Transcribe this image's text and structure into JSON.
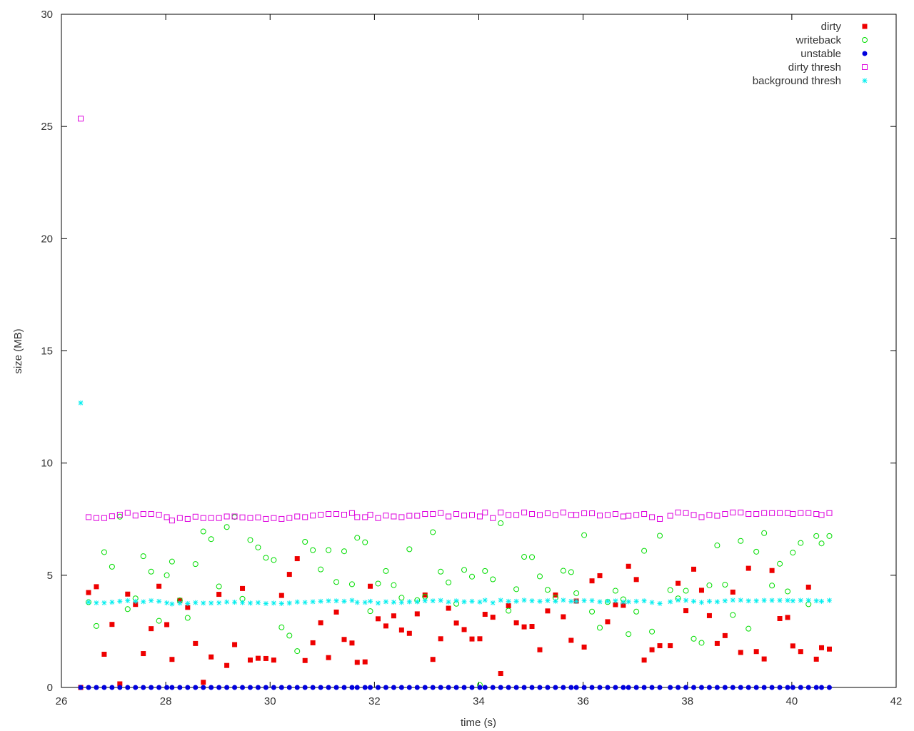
{
  "chart_data": {
    "type": "scatter",
    "title": "",
    "xlabel": "time (s)",
    "ylabel": "size (MB)",
    "xlim": [
      26,
      42
    ],
    "ylim": [
      0,
      30
    ],
    "xticks": [
      "26",
      "28",
      "30",
      "32",
      "34",
      "36",
      "38",
      "40",
      "42"
    ],
    "yticks": [
      "0",
      "5",
      "10",
      "15",
      "20",
      "25",
      "30"
    ],
    "grid": false,
    "legend_position": "top-right",
    "series": [
      {
        "name": "dirty",
        "color": "#ee0000",
        "marker": "filled-square",
        "x": [
          26.37,
          26.52,
          26.67,
          26.82,
          26.97,
          27.12,
          27.27,
          27.42,
          27.57,
          27.72,
          27.87,
          28.02,
          28.12,
          28.27,
          28.42,
          28.57,
          28.72,
          28.87,
          29.02,
          29.17,
          29.32,
          29.47,
          29.62,
          29.77,
          29.92,
          30.07,
          30.22,
          30.37,
          30.52,
          30.67,
          30.82,
          30.97,
          31.12,
          31.27,
          31.42,
          31.57,
          31.67,
          31.82,
          31.92,
          32.07,
          32.22,
          32.37,
          32.52,
          32.67,
          32.82,
          32.97,
          33.12,
          33.27,
          33.42,
          33.57,
          33.72,
          33.87,
          34.02,
          34.12,
          34.27,
          34.42,
          34.57,
          34.72,
          34.87,
          35.02,
          35.17,
          35.32,
          35.47,
          35.62,
          35.77,
          35.87,
          36.02,
          36.17,
          36.32,
          36.47,
          36.62,
          36.77,
          36.87,
          37.02,
          37.17,
          37.32,
          37.47,
          37.67,
          37.82,
          37.97,
          38.12,
          38.27,
          38.42,
          38.57,
          38.72,
          38.87,
          39.02,
          39.17,
          39.32,
          39.47,
          39.62,
          39.77,
          39.92,
          40.02,
          40.17,
          40.32,
          40.47,
          40.57,
          40.72
        ],
        "y": [
          0.0,
          4.23,
          4.49,
          1.48,
          2.81,
          0.16,
          4.16,
          3.7,
          1.51,
          2.62,
          4.51,
          2.8,
          1.25,
          3.88,
          3.57,
          1.96,
          0.23,
          1.36,
          4.15,
          0.98,
          1.91,
          4.41,
          1.22,
          1.3,
          1.29,
          1.22,
          4.1,
          5.04,
          5.74,
          1.2,
          1.99,
          2.88,
          1.33,
          3.36,
          2.14,
          1.98,
          1.12,
          1.14,
          4.51,
          3.06,
          2.74,
          3.19,
          2.56,
          2.41,
          3.28,
          4.12,
          1.25,
          2.17,
          3.53,
          2.87,
          2.58,
          2.16,
          2.17,
          3.26,
          3.13,
          0.62,
          3.64,
          2.88,
          2.7,
          2.72,
          1.68,
          3.41,
          4.12,
          3.15,
          2.1,
          3.85,
          1.8,
          4.75,
          4.98,
          2.93,
          3.69,
          3.66,
          5.4,
          4.81,
          1.22,
          1.68,
          1.86,
          1.86,
          4.64,
          3.42,
          5.27,
          4.33,
          3.2,
          1.96,
          2.31,
          4.25,
          1.56,
          5.31,
          1.6,
          1.27,
          5.21,
          3.07,
          3.12,
          1.85,
          1.6,
          4.47,
          1.26,
          1.77,
          1.71
        ]
      },
      {
        "name": "writeback",
        "color": "#00dd00",
        "marker": "open-circle",
        "x": [
          26.52,
          26.67,
          26.82,
          26.97,
          27.12,
          27.27,
          27.42,
          27.57,
          27.72,
          27.87,
          28.02,
          28.12,
          28.27,
          28.42,
          28.57,
          28.72,
          28.87,
          29.02,
          29.17,
          29.32,
          29.47,
          29.62,
          29.77,
          29.92,
          30.07,
          30.22,
          30.37,
          30.52,
          30.67,
          30.82,
          30.97,
          31.12,
          31.27,
          31.42,
          31.57,
          31.67,
          31.82,
          31.92,
          32.07,
          32.22,
          32.37,
          32.52,
          32.67,
          32.82,
          32.97,
          33.12,
          33.27,
          33.42,
          33.57,
          33.72,
          33.87,
          34.02,
          34.12,
          34.27,
          34.42,
          34.57,
          34.72,
          34.87,
          35.02,
          35.17,
          35.32,
          35.47,
          35.62,
          35.77,
          35.87,
          36.02,
          36.17,
          36.32,
          36.47,
          36.62,
          36.77,
          36.87,
          37.02,
          37.17,
          37.32,
          37.47,
          37.67,
          37.82,
          37.97,
          38.12,
          38.27,
          38.42,
          38.57,
          38.72,
          38.87,
          39.02,
          39.17,
          39.32,
          39.47,
          39.62,
          39.77,
          39.92,
          40.02,
          40.17,
          40.32,
          40.47,
          40.57,
          40.72
        ],
        "y": [
          3.8,
          2.74,
          6.03,
          5.38,
          7.61,
          3.49,
          3.97,
          5.85,
          5.16,
          2.97,
          5.0,
          5.61,
          3.88,
          3.1,
          5.5,
          6.95,
          6.61,
          4.5,
          7.15,
          7.6,
          3.95,
          6.57,
          6.24,
          5.78,
          5.68,
          2.68,
          2.31,
          1.62,
          6.49,
          6.12,
          5.26,
          6.12,
          4.7,
          6.07,
          4.6,
          6.67,
          6.47,
          3.4,
          4.63,
          5.19,
          4.56,
          4.0,
          6.16,
          3.89,
          4.05,
          6.92,
          5.16,
          4.68,
          3.73,
          5.24,
          4.94,
          0.11,
          5.19,
          4.82,
          7.32,
          3.42,
          4.38,
          5.82,
          5.81,
          4.95,
          4.35,
          4.0,
          5.2,
          5.14,
          4.2,
          6.79,
          3.38,
          2.66,
          3.81,
          4.31,
          3.93,
          2.38,
          3.38,
          6.09,
          2.49,
          6.76,
          4.34,
          3.97,
          4.31,
          2.17,
          1.99,
          4.55,
          6.33,
          4.58,
          3.23,
          6.53,
          2.62,
          6.05,
          6.88,
          4.54,
          5.51,
          4.28,
          6.01,
          6.44,
          3.71,
          6.75,
          6.42,
          6.75
        ]
      },
      {
        "name": "unstable",
        "color": "#0000dd",
        "marker": "filled-circle",
        "x": [
          26.37,
          26.52,
          26.67,
          26.82,
          26.97,
          27.12,
          27.27,
          27.42,
          27.57,
          27.72,
          27.87,
          28.02,
          28.12,
          28.27,
          28.42,
          28.57,
          28.72,
          28.87,
          29.02,
          29.17,
          29.32,
          29.47,
          29.62,
          29.77,
          29.92,
          30.07,
          30.22,
          30.37,
          30.52,
          30.67,
          30.82,
          30.97,
          31.12,
          31.27,
          31.42,
          31.57,
          31.67,
          31.82,
          31.92,
          32.07,
          32.22,
          32.37,
          32.52,
          32.67,
          32.82,
          32.97,
          33.12,
          33.27,
          33.42,
          33.57,
          33.72,
          33.87,
          34.02,
          34.12,
          34.27,
          34.42,
          34.57,
          34.72,
          34.87,
          35.02,
          35.17,
          35.32,
          35.47,
          35.62,
          35.77,
          35.87,
          36.02,
          36.17,
          36.32,
          36.47,
          36.62,
          36.77,
          36.87,
          37.02,
          37.17,
          37.32,
          37.47,
          37.67,
          37.82,
          37.97,
          38.12,
          38.27,
          38.42,
          38.57,
          38.72,
          38.87,
          39.02,
          39.17,
          39.32,
          39.47,
          39.62,
          39.77,
          39.92,
          40.02,
          40.17,
          40.32,
          40.47,
          40.57,
          40.72
        ],
        "y": [
          0,
          0,
          0,
          0,
          0,
          0,
          0,
          0,
          0,
          0,
          0,
          0,
          0,
          0,
          0,
          0,
          0,
          0,
          0,
          0,
          0,
          0,
          0,
          0,
          0,
          0,
          0,
          0,
          0,
          0,
          0,
          0,
          0,
          0,
          0,
          0,
          0,
          0,
          0,
          0,
          0,
          0,
          0,
          0,
          0,
          0,
          0,
          0,
          0,
          0,
          0,
          0,
          0,
          0,
          0,
          0,
          0,
          0,
          0,
          0,
          0,
          0,
          0,
          0,
          0,
          0,
          0,
          0,
          0,
          0,
          0,
          0,
          0,
          0,
          0,
          0,
          0,
          0,
          0,
          0,
          0,
          0,
          0,
          0,
          0,
          0,
          0,
          0,
          0,
          0,
          0,
          0,
          0,
          0,
          0,
          0,
          0,
          0,
          0
        ]
      },
      {
        "name": "dirty thresh",
        "color": "#dd00dd",
        "marker": "open-square",
        "x": [
          26.37,
          26.52,
          26.67,
          26.82,
          26.97,
          27.12,
          27.27,
          27.42,
          27.57,
          27.72,
          27.87,
          28.02,
          28.12,
          28.27,
          28.42,
          28.57,
          28.72,
          28.87,
          29.02,
          29.17,
          29.32,
          29.47,
          29.62,
          29.77,
          29.92,
          30.07,
          30.22,
          30.37,
          30.52,
          30.67,
          30.82,
          30.97,
          31.12,
          31.27,
          31.42,
          31.57,
          31.67,
          31.82,
          31.92,
          32.07,
          32.22,
          32.37,
          32.52,
          32.67,
          32.82,
          32.97,
          33.12,
          33.27,
          33.42,
          33.57,
          33.72,
          33.87,
          34.02,
          34.12,
          34.27,
          34.42,
          34.57,
          34.72,
          34.87,
          35.02,
          35.17,
          35.32,
          35.47,
          35.62,
          35.77,
          35.87,
          36.02,
          36.17,
          36.32,
          36.47,
          36.62,
          36.77,
          36.87,
          37.02,
          37.17,
          37.32,
          37.47,
          37.67,
          37.82,
          37.97,
          38.12,
          38.27,
          38.42,
          38.57,
          38.72,
          38.87,
          39.02,
          39.17,
          39.32,
          39.47,
          39.62,
          39.77,
          39.92,
          40.02,
          40.17,
          40.32,
          40.47,
          40.57,
          40.72
        ],
        "y": [
          25.35,
          7.59,
          7.55,
          7.55,
          7.63,
          7.7,
          7.78,
          7.66,
          7.73,
          7.73,
          7.7,
          7.59,
          7.44,
          7.55,
          7.51,
          7.61,
          7.55,
          7.55,
          7.55,
          7.62,
          7.62,
          7.58,
          7.55,
          7.58,
          7.51,
          7.55,
          7.51,
          7.55,
          7.62,
          7.59,
          7.66,
          7.7,
          7.73,
          7.73,
          7.7,
          7.77,
          7.59,
          7.59,
          7.7,
          7.55,
          7.66,
          7.62,
          7.59,
          7.65,
          7.65,
          7.73,
          7.73,
          7.77,
          7.62,
          7.73,
          7.66,
          7.69,
          7.62,
          7.8,
          7.55,
          7.8,
          7.69,
          7.69,
          7.8,
          7.73,
          7.69,
          7.76,
          7.69,
          7.8,
          7.69,
          7.69,
          7.76,
          7.76,
          7.66,
          7.69,
          7.73,
          7.62,
          7.65,
          7.69,
          7.73,
          7.59,
          7.51,
          7.65,
          7.8,
          7.77,
          7.69,
          7.59,
          7.69,
          7.65,
          7.73,
          7.8,
          7.8,
          7.73,
          7.73,
          7.77,
          7.77,
          7.77,
          7.77,
          7.73,
          7.77,
          7.77,
          7.73,
          7.69,
          7.77
        ]
      },
      {
        "name": "background thresh",
        "color": "#00eeee",
        "marker": "star",
        "x": [
          26.37,
          26.52,
          26.67,
          26.82,
          26.97,
          27.12,
          27.27,
          27.42,
          27.57,
          27.72,
          27.87,
          28.02,
          28.12,
          28.27,
          28.42,
          28.57,
          28.72,
          28.87,
          29.02,
          29.17,
          29.32,
          29.47,
          29.62,
          29.77,
          29.92,
          30.07,
          30.22,
          30.37,
          30.52,
          30.67,
          30.82,
          30.97,
          31.12,
          31.27,
          31.42,
          31.57,
          31.67,
          31.82,
          31.92,
          32.07,
          32.22,
          32.37,
          32.52,
          32.67,
          32.82,
          32.97,
          33.12,
          33.27,
          33.42,
          33.57,
          33.72,
          33.87,
          34.02,
          34.12,
          34.27,
          34.42,
          34.57,
          34.72,
          34.87,
          35.02,
          35.17,
          35.32,
          35.47,
          35.62,
          35.77,
          35.87,
          36.02,
          36.17,
          36.32,
          36.47,
          36.62,
          36.77,
          36.87,
          37.02,
          37.17,
          37.32,
          37.47,
          37.67,
          37.82,
          37.97,
          38.12,
          38.27,
          38.42,
          38.57,
          38.72,
          38.87,
          39.02,
          39.17,
          39.32,
          39.47,
          39.62,
          39.77,
          39.92,
          40.02,
          40.17,
          40.32,
          40.47,
          40.57,
          40.72
        ],
        "y": [
          12.68,
          3.8,
          3.77,
          3.77,
          3.8,
          3.84,
          3.87,
          3.84,
          3.82,
          3.87,
          3.84,
          3.77,
          3.72,
          3.76,
          3.74,
          3.78,
          3.76,
          3.76,
          3.77,
          3.81,
          3.8,
          3.78,
          3.76,
          3.78,
          3.74,
          3.76,
          3.74,
          3.76,
          3.81,
          3.79,
          3.82,
          3.84,
          3.86,
          3.86,
          3.84,
          3.88,
          3.79,
          3.79,
          3.84,
          3.76,
          3.82,
          3.8,
          3.79,
          3.82,
          3.82,
          3.86,
          3.86,
          3.88,
          3.81,
          3.86,
          3.82,
          3.84,
          3.81,
          3.89,
          3.77,
          3.89,
          3.84,
          3.84,
          3.89,
          3.86,
          3.84,
          3.87,
          3.84,
          3.89,
          3.84,
          3.84,
          3.87,
          3.87,
          3.82,
          3.84,
          3.86,
          3.81,
          3.82,
          3.84,
          3.86,
          3.79,
          3.74,
          3.82,
          3.89,
          3.88,
          3.84,
          3.79,
          3.84,
          3.82,
          3.86,
          3.89,
          3.89,
          3.86,
          3.86,
          3.88,
          3.88,
          3.88,
          3.88,
          3.86,
          3.88,
          3.88,
          3.86,
          3.84,
          3.88
        ]
      }
    ]
  }
}
